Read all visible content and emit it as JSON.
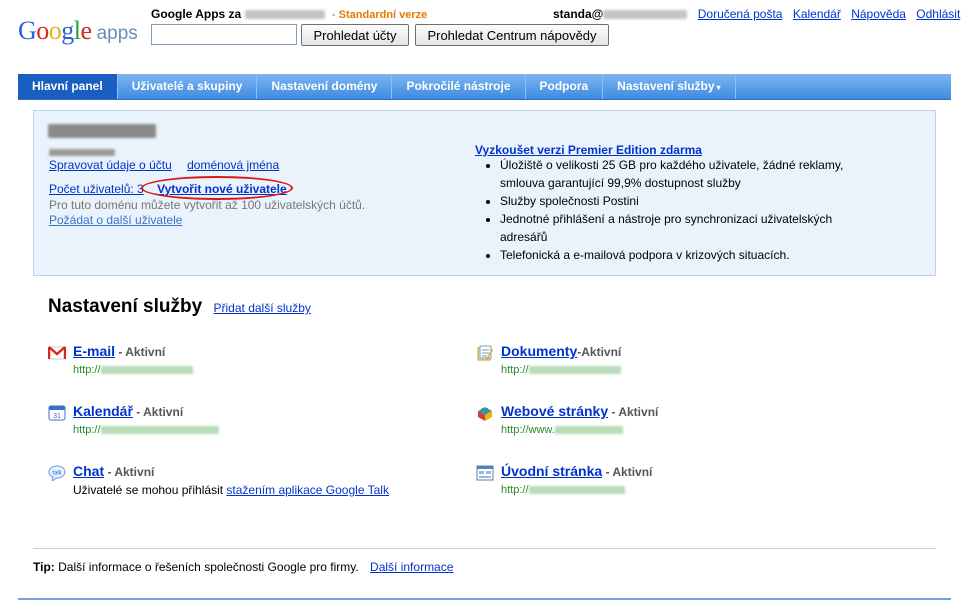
{
  "header": {
    "logo_google": "Google",
    "logo_apps": "apps",
    "title_prefix": "Google Apps za",
    "edition_dash": "-",
    "edition": "Standardní verze",
    "search_placeholder": "",
    "search_value": "",
    "btn_search_accounts": "Prohledat účty",
    "btn_search_help": "Prohledat Centrum nápovědy",
    "user_prefix": "standa@",
    "links": [
      "Doručená pošta",
      "Kalendář",
      "Nápověda",
      "Odhlásit"
    ]
  },
  "nav": {
    "tabs": [
      "Hlavní panel",
      "Uživatelé a skupiny",
      "Nastavení domény",
      "Pokročilé nástroje",
      "Podpora",
      "Nastavení služby"
    ],
    "caret": "▾"
  },
  "panel": {
    "manage_account": "Spravovat údaje o účtu",
    "domain_names": "doménová jména",
    "user_count": "Počet uživatelů: 3",
    "create_users": "Vytvořit nové uživatele",
    "note": "Pro tuto doménu můžete vytvořit až 100 uživatelských účtů.",
    "request_more": "Požádat o další uživatele",
    "premier_link": "Vyzkoušet verzi Premier Edition zdarma",
    "features": [
      "Úložiště o velikosti 25 GB pro každého uživatele, žádné reklamy, smlouva garantující 99,9% dostupnost služby",
      "Služby společnosti Postini",
      "Jednotné přihlášení a nástroje pro synchronizaci uživatelských adresářů",
      "Telefonická a e-mailová podpora v krizových situacích."
    ]
  },
  "services": {
    "title": "Nastavení služby",
    "add_link": "Přidat další služby",
    "items": {
      "email": {
        "name": "E-mail",
        "status": " - Aktivní",
        "url_prefix": "http://",
        "icon": "gmail-icon"
      },
      "docs": {
        "name": "Dokumenty",
        "status": "-Aktivní",
        "url_prefix": "http://",
        "icon": "docs-icon"
      },
      "calendar": {
        "name": "Kalendář",
        "status": " - Aktivní",
        "url_prefix": "http://",
        "icon": "calendar-icon"
      },
      "sites": {
        "name": "Webové stránky",
        "status": " - Aktivní",
        "url_prefix": "http://www.",
        "icon": "sites-icon"
      },
      "chat": {
        "name": "Chat",
        "status": " - Aktivní",
        "desc_prefix": "Uživatelé se mohou přihlásit",
        "desc_link": "stažením aplikace Google Talk",
        "icon": "talk-icon"
      },
      "start": {
        "name": "Úvodní stránka",
        "status": " - Aktivní",
        "url_prefix": "http://",
        "icon": "start-page-icon"
      }
    }
  },
  "footer": {
    "tip_label": "Tip:",
    "tip_text": "Další informace o řešeních společnosti Google pro firmy.",
    "more_info": "Další informace"
  }
}
